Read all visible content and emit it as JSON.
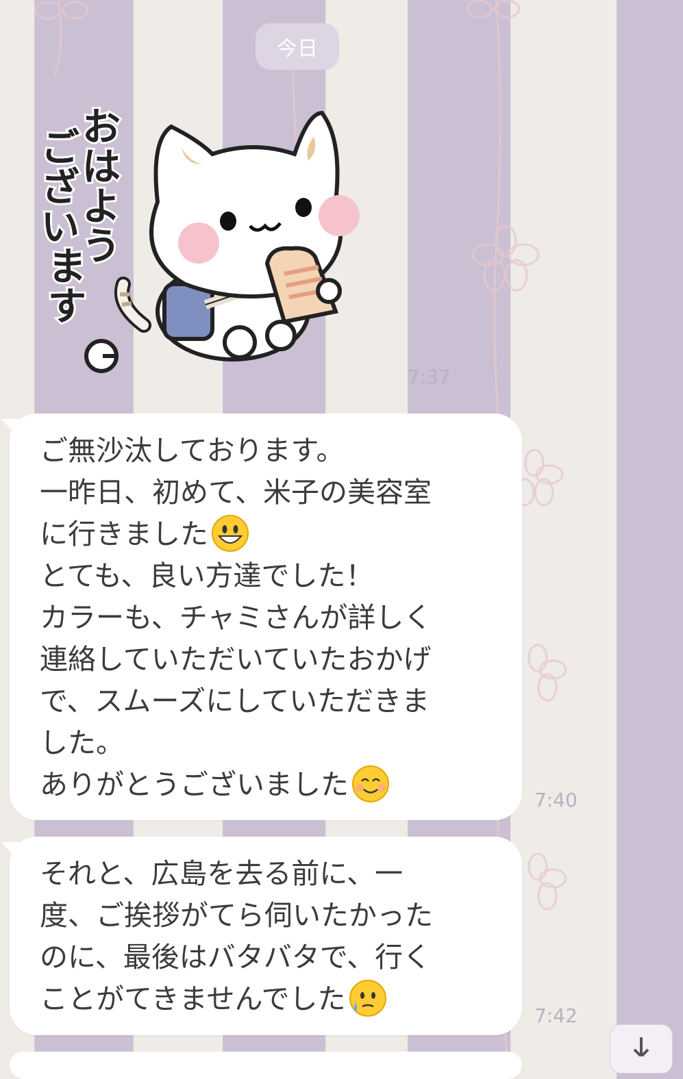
{
  "date_separator": "今日",
  "sticker": {
    "text": "おはようございます",
    "time": "7:37"
  },
  "messages": [
    {
      "lines": [
        "ご無沙汰しております。",
        "一昨日、初めて、米子の美容室",
        "に行きました",
        "とても、良い方達でした！",
        "カラーも、チャミさんが詳しく",
        "連絡していただいていたおかげ",
        "で、スムーズにしていただきま",
        "した。",
        "ありがとうございました"
      ],
      "emojis": {
        "2": "grinning-face-emoji",
        "8": "smiling-face-emoji"
      },
      "time": "7:40"
    },
    {
      "lines": [
        "それと、広島を去る前に、一",
        "度、ご挨拶がてら伺いたかった",
        "のに、最後はバタバタで、行く",
        "ことがてきませんでした"
      ],
      "emojis": {
        "3": "tearful-face-emoji"
      },
      "time": "7:42"
    }
  ],
  "scroll_button_icon": "arrow-down-icon",
  "colors": {
    "stripe_light": "#efebe7",
    "stripe_purple": "#cbbfd3",
    "bubble": "#ffffff",
    "timestamp": "#b9b0c1"
  }
}
